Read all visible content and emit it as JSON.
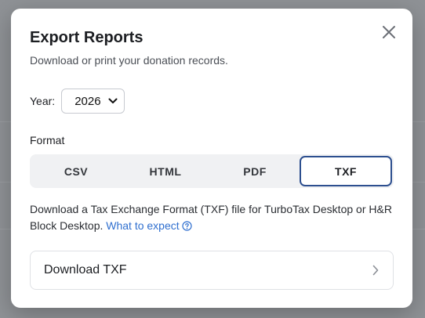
{
  "modal": {
    "title": "Export Reports",
    "subtitle": "Download or print your donation records."
  },
  "year": {
    "label": "Year:",
    "selected": "2026"
  },
  "format": {
    "label": "Format",
    "options": [
      "CSV",
      "HTML",
      "PDF",
      "TXF"
    ],
    "selected": "TXF"
  },
  "description": {
    "text": "Download a Tax Exchange Format (TXF) file for TurboTax Desktop or H&R Block Desktop. ",
    "link": "What to expect"
  },
  "download": {
    "label": "Download TXF"
  },
  "colors": {
    "accent": "#2d4f8f",
    "link": "#2f6fcf",
    "overlay": "#8f9296"
  },
  "icons": {
    "close": "close-icon",
    "select": "chevron-down-icon",
    "help": "question-circle-icon",
    "row": "chevron-right-icon"
  }
}
